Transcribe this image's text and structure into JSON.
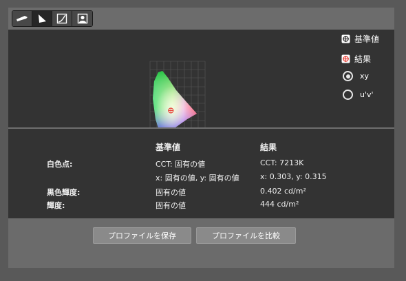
{
  "toolbar": {
    "tabs": [
      {
        "icon": "monitor-tab-icon",
        "active": false
      },
      {
        "icon": "color-space-tab-icon",
        "active": true
      },
      {
        "icon": "curve-tab-icon",
        "active": false
      },
      {
        "icon": "user-profile-tab-icon",
        "active": false
      }
    ]
  },
  "legend": {
    "reference_label": "基準値",
    "result_label": "結果"
  },
  "options": {
    "xy_label": "xy",
    "uv_label": "u'v'",
    "selected": "xy"
  },
  "chart_data": {
    "type": "scatter",
    "title": "",
    "xlim": [
      0,
      0.8
    ],
    "ylim": [
      0,
      0.9
    ],
    "grid": true,
    "points": [
      {
        "name": "result",
        "x": 0.303,
        "y": 0.315
      }
    ]
  },
  "table": {
    "col_reference": "基準値",
    "col_result": "結果",
    "rows": [
      {
        "label": "白色点:",
        "reference": "CCT: 固有の値",
        "result": "CCT: 7213K"
      },
      {
        "label": "",
        "reference": "x: 固有の値, y: 固有の値",
        "result": "x: 0.303, y: 0.315"
      },
      {
        "label": "黒色輝度:",
        "reference": "固有の値",
        "result": "0.402 cd/m²"
      },
      {
        "label": "輝度:",
        "reference": "固有の値",
        "result": "444 cd/m²"
      }
    ]
  },
  "buttons": {
    "save_profile": "プロファイルを保存",
    "compare_profile": "プロファイルを比較"
  },
  "colors": {
    "reference_marker": "#ffffff",
    "result_marker": "#e8453c"
  }
}
